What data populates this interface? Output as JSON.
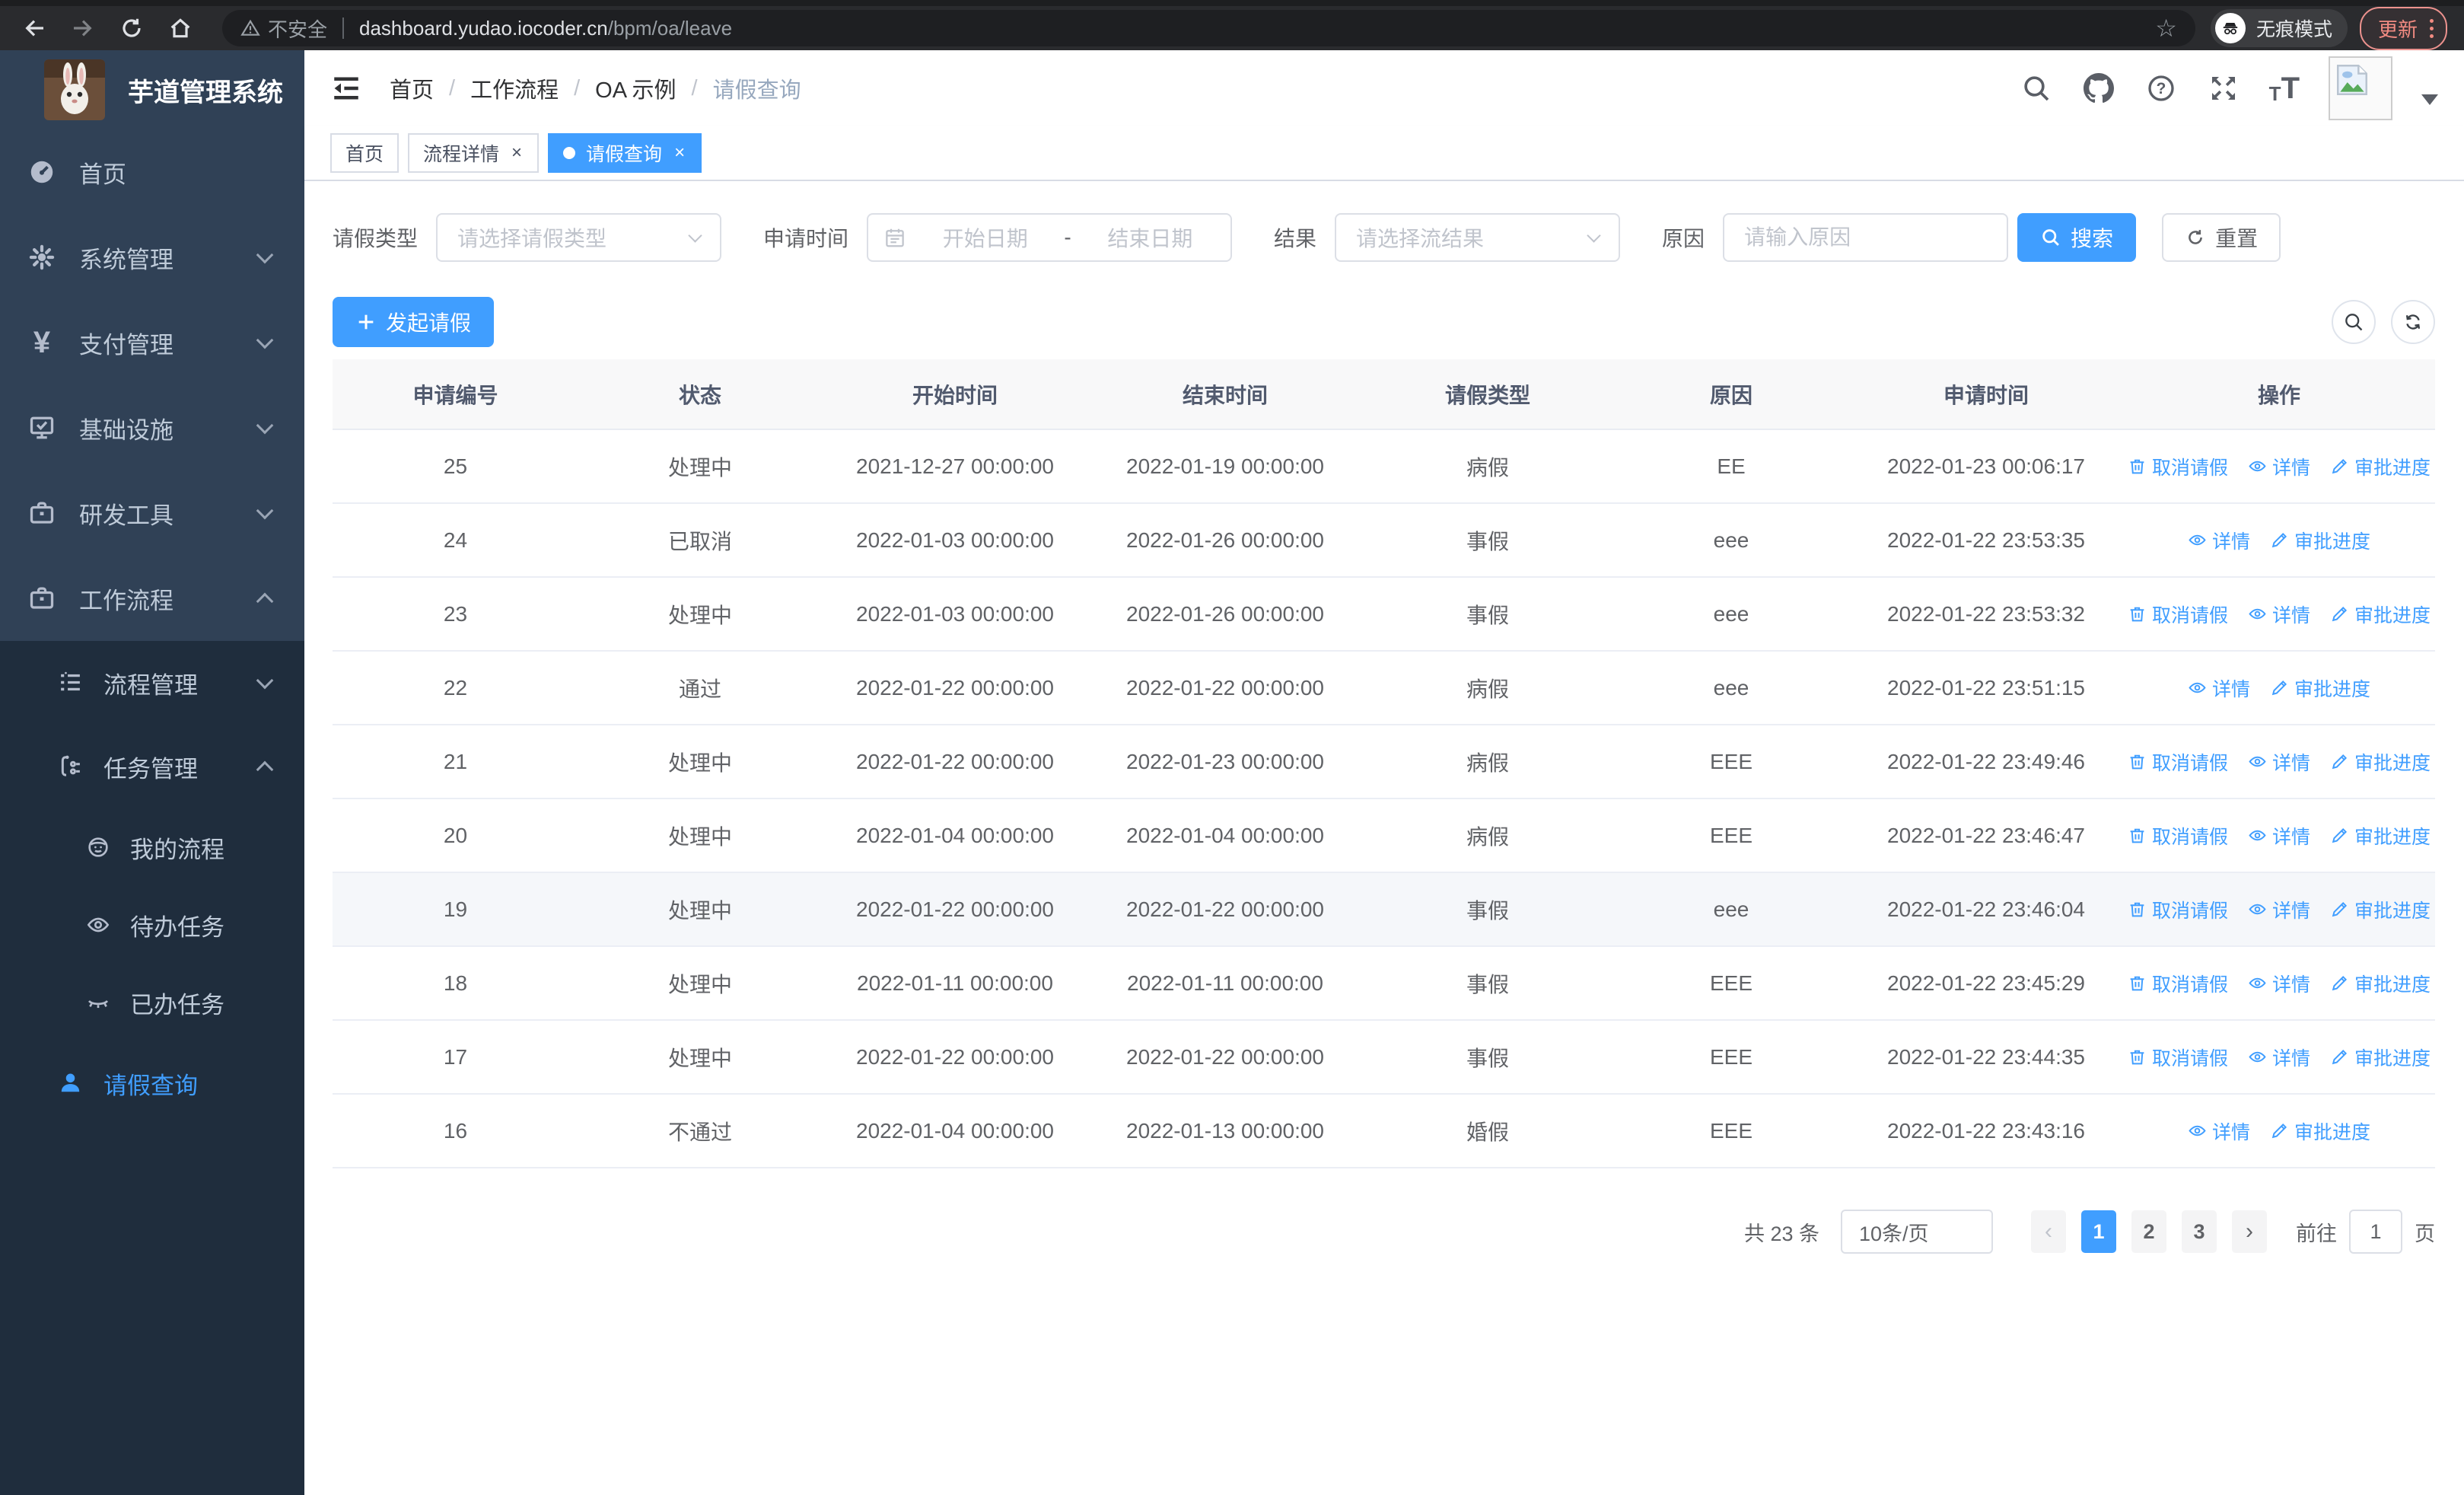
{
  "browser": {
    "security_label": "不安全",
    "url_host": "dashboard.yudao.iocoder.cn",
    "url_path": "/bpm/oa/leave",
    "incognito_label": "无痕模式",
    "update_label": "更新"
  },
  "sidebar": {
    "app_title": "芋道管理系统",
    "menu": [
      {
        "label": "首页",
        "icon": "dashboard-icon"
      },
      {
        "label": "系统管理",
        "icon": "gear-icon"
      },
      {
        "label": "支付管理",
        "icon": "yen-icon"
      },
      {
        "label": "基础设施",
        "icon": "monitor-icon"
      },
      {
        "label": "研发工具",
        "icon": "briefcase-icon"
      },
      {
        "label": "工作流程",
        "icon": "briefcase-icon",
        "expanded": true
      }
    ],
    "submenu": [
      {
        "label": "流程管理",
        "icon": "list-icon"
      },
      {
        "label": "任务管理",
        "icon": "tree-icon",
        "expanded": true
      }
    ],
    "task_items": [
      {
        "label": "我的流程",
        "icon": "face-icon"
      },
      {
        "label": "待办任务",
        "icon": "eye-icon"
      },
      {
        "label": "已办任务",
        "icon": "eye-closed-icon"
      }
    ],
    "leave_item": {
      "label": "请假查询",
      "icon": "user-icon",
      "active": true
    }
  },
  "navbar": {
    "breadcrumb": [
      "首页",
      "工作流程",
      "OA 示例",
      "请假查询"
    ]
  },
  "tabs": [
    {
      "label": "首页",
      "closable": false,
      "active": false
    },
    {
      "label": "流程详情",
      "closable": true,
      "active": false
    },
    {
      "label": "请假查询",
      "closable": true,
      "active": true
    }
  ],
  "filters": {
    "leave_type_label": "请假类型",
    "leave_type_placeholder": "请选择请假类型",
    "apply_time_label": "申请时间",
    "start_placeholder": "开始日期",
    "range_separator": "-",
    "end_placeholder": "结束日期",
    "result_label": "结果",
    "result_placeholder": "请选择流结果",
    "reason_label": "原因",
    "reason_placeholder": "请输入原因",
    "search_label": "搜索",
    "reset_label": "重置"
  },
  "toolbar": {
    "create_label": "发起请假"
  },
  "table": {
    "columns": [
      "申请编号",
      "状态",
      "开始时间",
      "结束时间",
      "请假类型",
      "原因",
      "申请时间",
      "操作"
    ],
    "action_labels": {
      "cancel": "取消请假",
      "detail": "详情",
      "audit": "审批进度"
    },
    "rows": [
      {
        "id": "25",
        "status": "处理中",
        "start": "2021-12-27 00:00:00",
        "end": "2022-01-19 00:00:00",
        "type": "病假",
        "reason": "EE",
        "applied": "2022-01-23 00:06:17",
        "cancelable": true,
        "highlighted": false
      },
      {
        "id": "24",
        "status": "已取消",
        "start": "2022-01-03 00:00:00",
        "end": "2022-01-26 00:00:00",
        "type": "事假",
        "reason": "eee",
        "applied": "2022-01-22 23:53:35",
        "cancelable": false,
        "highlighted": false
      },
      {
        "id": "23",
        "status": "处理中",
        "start": "2022-01-03 00:00:00",
        "end": "2022-01-26 00:00:00",
        "type": "事假",
        "reason": "eee",
        "applied": "2022-01-22 23:53:32",
        "cancelable": true,
        "highlighted": false
      },
      {
        "id": "22",
        "status": "通过",
        "start": "2022-01-22 00:00:00",
        "end": "2022-01-22 00:00:00",
        "type": "病假",
        "reason": "eee",
        "applied": "2022-01-22 23:51:15",
        "cancelable": false,
        "highlighted": false
      },
      {
        "id": "21",
        "status": "处理中",
        "start": "2022-01-22 00:00:00",
        "end": "2022-01-23 00:00:00",
        "type": "病假",
        "reason": "EEE",
        "applied": "2022-01-22 23:49:46",
        "cancelable": true,
        "highlighted": false
      },
      {
        "id": "20",
        "status": "处理中",
        "start": "2022-01-04 00:00:00",
        "end": "2022-01-04 00:00:00",
        "type": "病假",
        "reason": "EEE",
        "applied": "2022-01-22 23:46:47",
        "cancelable": true,
        "highlighted": false
      },
      {
        "id": "19",
        "status": "处理中",
        "start": "2022-01-22 00:00:00",
        "end": "2022-01-22 00:00:00",
        "type": "事假",
        "reason": "eee",
        "applied": "2022-01-22 23:46:04",
        "cancelable": true,
        "highlighted": true
      },
      {
        "id": "18",
        "status": "处理中",
        "start": "2022-01-11 00:00:00",
        "end": "2022-01-11 00:00:00",
        "type": "事假",
        "reason": "EEE",
        "applied": "2022-01-22 23:45:29",
        "cancelable": true,
        "highlighted": false
      },
      {
        "id": "17",
        "status": "处理中",
        "start": "2022-01-22 00:00:00",
        "end": "2022-01-22 00:00:00",
        "type": "事假",
        "reason": "EEE",
        "applied": "2022-01-22 23:44:35",
        "cancelable": true,
        "highlighted": false
      },
      {
        "id": "16",
        "status": "不通过",
        "start": "2022-01-04 00:00:00",
        "end": "2022-01-13 00:00:00",
        "type": "婚假",
        "reason": "EEE",
        "applied": "2022-01-22 23:43:16",
        "cancelable": false,
        "highlighted": false
      }
    ]
  },
  "pagination": {
    "total_label": "共 23 条",
    "page_size_label": "10条/页",
    "pages": [
      "1",
      "2",
      "3"
    ],
    "active_page": "1",
    "goto_label": "前往",
    "goto_value": "1",
    "unit_label": "页"
  },
  "colors": {
    "primary": "#409eff",
    "sidebar_bg": "#304156",
    "submenu_bg": "#1f2d3d",
    "danger_accent": "#f28b82"
  }
}
